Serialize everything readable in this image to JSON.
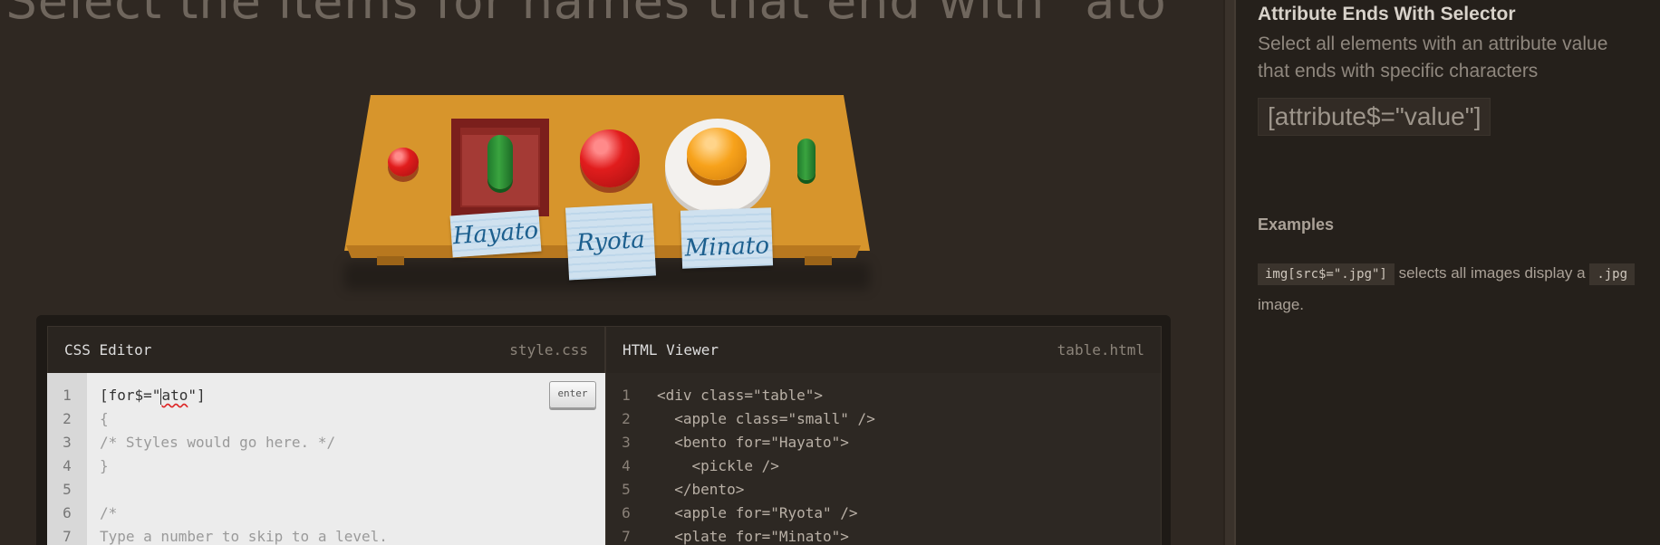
{
  "instruction": "Select the items for names that end with \"ato\"",
  "table": {
    "tags": [
      "Hayato",
      "Ryota",
      "Minato"
    ]
  },
  "css_editor": {
    "title": "CSS Editor",
    "file": "style.css",
    "enter_label": "enter",
    "line_numbers": [
      "1",
      "2",
      "3",
      "4",
      "5",
      "6",
      "7"
    ],
    "input_before_caret": "[for$=\"",
    "input_after_caret": "ato",
    "input_tail": "\"]",
    "lines": [
      "{",
      "/* Styles would go here. */",
      "}",
      "",
      "/*",
      "Type a number to skip to a level."
    ]
  },
  "html_viewer": {
    "title": "HTML Viewer",
    "file": "table.html",
    "line_numbers": [
      "1",
      "2",
      "3",
      "4",
      "5",
      "6",
      "7"
    ],
    "lines": [
      "<div class=\"table\">",
      "  <apple class=\"small\" />",
      "  <bento for=\"Hayato\">",
      "    <pickle />",
      "  </bento>",
      "  <apple for=\"Ryota\" />",
      "  <plate for=\"Minato\">"
    ]
  },
  "sidebar": {
    "title": "Attribute Ends With Selector",
    "description": "Select all elements with an attribute value that ends with specific characters",
    "syntax": "[attribute$=\"value\"]",
    "examples_title": "Examples",
    "example_code_1": "img[src$=\".jpg\"]",
    "example_text_1": "selects all images display a",
    "example_code_2": ".jpg",
    "example_text_2": "image."
  }
}
